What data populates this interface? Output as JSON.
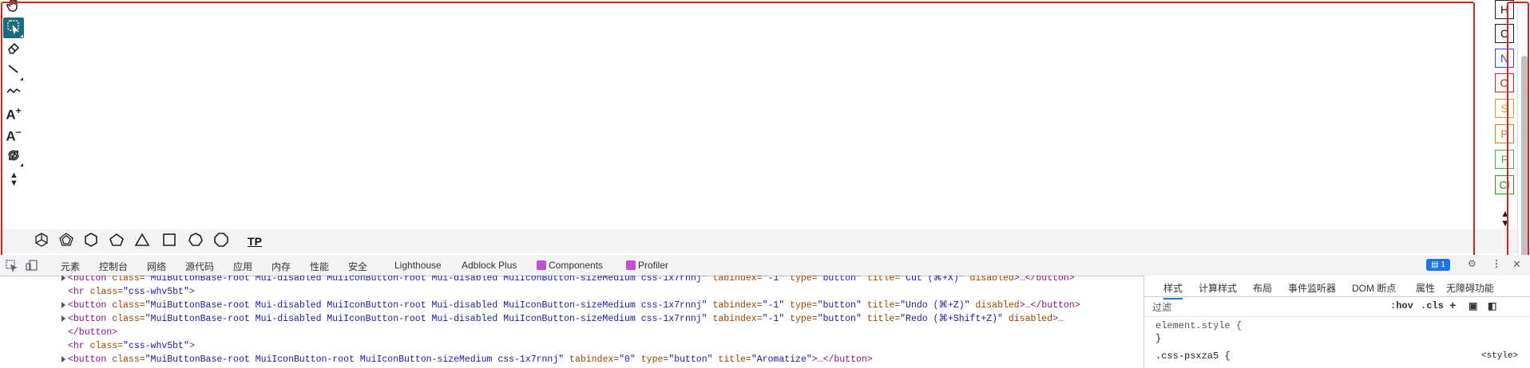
{
  "toolbar": {
    "left_tools": [
      {
        "name": "hand-icon",
        "label": "pan"
      },
      {
        "name": "lasso-select-icon",
        "label": "select",
        "active": true
      },
      {
        "name": "eraser-icon",
        "label": "erase"
      },
      {
        "name": "bond-icon",
        "label": "single bond"
      },
      {
        "name": "chain-icon",
        "label": "chain"
      },
      {
        "name": "charge-plus-icon",
        "label": "A+"
      },
      {
        "name": "charge-minus-icon",
        "label": "A−"
      },
      {
        "name": "rotate-icon",
        "label": "rotate"
      },
      {
        "name": "arrows-up-down-icon",
        "label": "▲▼"
      }
    ],
    "shapes": [
      "cyclohexane-chair-icon",
      "cyclopentane-outline-icon",
      "hexagon-icon",
      "pentagon-icon",
      "triangle-icon",
      "square-icon",
      "heptagon-icon",
      "octagon-icon"
    ],
    "tp_label": "TP",
    "atoms": [
      {
        "symbol": "H",
        "color": "#111111",
        "border": "#222222"
      },
      {
        "symbol": "C",
        "color": "#111111",
        "border": "#222222"
      },
      {
        "symbol": "N",
        "color": "#1f4fe0",
        "border": "#1f4fe0"
      },
      {
        "symbol": "O",
        "color": "#e02020",
        "border": "#e02020"
      },
      {
        "symbol": "S",
        "color": "#d8a020",
        "border": "#d8a020"
      },
      {
        "symbol": "P",
        "color": "#e07820",
        "border": "#e07820"
      },
      {
        "symbol": "F",
        "color": "#49b049",
        "border": "#49b049"
      },
      {
        "symbol": "Cl",
        "color": "#22a022",
        "border": "#22a022"
      }
    ],
    "updown_label": "▲▼"
  },
  "devtools": {
    "tabs": [
      "元素",
      "控制台",
      "网络",
      "源代码",
      "应用",
      "内存",
      "性能",
      "安全",
      "Lighthouse",
      "Adblock Plus",
      "Components",
      "Profiler"
    ],
    "message_count": "1",
    "close_label": "✕",
    "elements_lines": [
      {
        "indent": 1,
        "caret": true,
        "parts": [
          [
            "tag",
            "<button "
          ],
          [
            "attr",
            "class="
          ],
          [
            "val",
            "\"MuiButtonBase-root Mui-disabled MuiIconButton-root Mui-disabled MuiIconButton-sizeMedium css-1x7rnnj\""
          ],
          [
            "attr",
            " tabindex="
          ],
          [
            "val",
            "\"-1\""
          ],
          [
            "attr",
            " type="
          ],
          [
            "val",
            "\"button\""
          ],
          [
            "attr",
            " title="
          ],
          [
            "val",
            "\"Cut (⌘+X)\""
          ],
          [
            "attr",
            " disabled"
          ],
          [
            "tag",
            ">"
          ],
          [
            "ellip",
            "…"
          ],
          [
            "tag",
            "</button>"
          ]
        ]
      },
      {
        "indent": 1,
        "caret": false,
        "parts": [
          [
            "tag",
            "<hr "
          ],
          [
            "attr",
            "class="
          ],
          [
            "val",
            "\"css-whv5bt\""
          ],
          [
            "tag",
            ">"
          ]
        ]
      },
      {
        "indent": 1,
        "caret": true,
        "parts": [
          [
            "tag",
            "<button "
          ],
          [
            "attr",
            "class="
          ],
          [
            "val",
            "\"MuiButtonBase-root Mui-disabled MuiIconButton-root Mui-disabled MuiIconButton-sizeMedium css-1x7rnnj\""
          ],
          [
            "attr",
            " tabindex="
          ],
          [
            "val",
            "\"-1\""
          ],
          [
            "attr",
            " type="
          ],
          [
            "val",
            "\"button\""
          ],
          [
            "attr",
            " title="
          ],
          [
            "val",
            "\"Undo (⌘+Z)\""
          ],
          [
            "attr",
            " disabled"
          ],
          [
            "tag",
            ">"
          ],
          [
            "ellip",
            "…"
          ],
          [
            "tag",
            "</button>"
          ]
        ]
      },
      {
        "indent": 1,
        "caret": true,
        "parts": [
          [
            "tag",
            "<button "
          ],
          [
            "attr",
            "class="
          ],
          [
            "val",
            "\"MuiButtonBase-root Mui-disabled MuiIconButton-root Mui-disabled MuiIconButton-sizeMedium css-1x7rnnj\""
          ],
          [
            "attr",
            " tabindex="
          ],
          [
            "val",
            "\"-1\""
          ],
          [
            "attr",
            " type="
          ],
          [
            "val",
            "\"button\""
          ],
          [
            "attr",
            " title="
          ],
          [
            "val",
            "\"Redo (⌘+Shift+Z)\""
          ],
          [
            "attr",
            " disabled"
          ],
          [
            "tag",
            ">"
          ],
          [
            "ellip",
            "…"
          ]
        ]
      },
      {
        "indent": 1,
        "caret": false,
        "parts": [
          [
            "tag",
            "</button>"
          ]
        ]
      },
      {
        "indent": 1,
        "caret": false,
        "parts": [
          [
            "tag",
            "<hr "
          ],
          [
            "attr",
            "class="
          ],
          [
            "val",
            "\"css-whv5bt\""
          ],
          [
            "tag",
            ">"
          ]
        ]
      },
      {
        "indent": 1,
        "caret": true,
        "parts": [
          [
            "tag",
            "<button "
          ],
          [
            "attr",
            "class="
          ],
          [
            "val",
            "\"MuiButtonBase-root MuiIconButton-root MuiIconButton-sizeMedium css-1x7rnnj\""
          ],
          [
            "attr",
            " tabindex="
          ],
          [
            "val",
            "\"0\""
          ],
          [
            "attr",
            " type="
          ],
          [
            "val",
            "\"button\""
          ],
          [
            "attr",
            " title="
          ],
          [
            "val",
            "\"Aromatize\""
          ],
          [
            "tag",
            ">"
          ],
          [
            "ellip",
            "…"
          ],
          [
            "tag",
            "</button>"
          ]
        ]
      }
    ],
    "styles_tabs": [
      "样式",
      "计算样式",
      "布局",
      "事件监听器",
      "DOM 断点",
      "属性",
      "无障碍功能"
    ],
    "filter_placeholder": "过滤",
    "hov_label": ":hov",
    "cls_label": ".cls",
    "plus_label": "+",
    "element_style": "element.style {",
    "close_brace": "}",
    "rule_selector": ".css-psxza5 {",
    "rule_source": "<style>"
  }
}
